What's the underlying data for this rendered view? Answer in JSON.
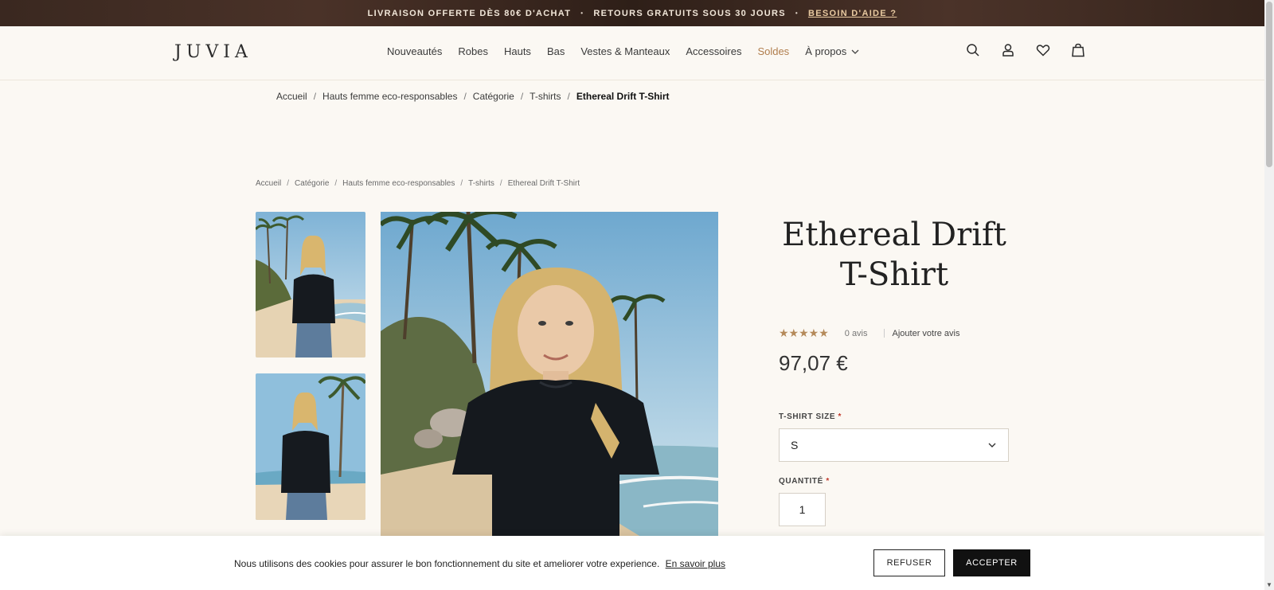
{
  "topbar": {
    "item1": "LIVRAISON OFFERTE DÈS 80€ D'ACHAT",
    "item2": "RETOURS GRATUITS SOUS 30 JOURS",
    "help": "BESOIN D'AIDE ?",
    "separator": "•"
  },
  "header": {
    "logo": "JUVIA",
    "nav": [
      "Nouveautés",
      "Robes",
      "Hauts",
      "Bas",
      "Vestes & Manteaux",
      "Accessoires",
      "Soldes",
      "À propos"
    ],
    "icons": [
      "search-icon",
      "account-icon",
      "heart-icon",
      "bag-icon"
    ]
  },
  "breadcrumb_top": [
    "Accueil",
    "Hauts femme eco-responsables",
    "Catégorie",
    "T-shirts",
    "Ethereal Drift T-Shirt"
  ],
  "breadcrumb_small": [
    "Accueil",
    "Catégorie",
    "Hauts femme eco-responsables",
    "T-shirts",
    "Ethereal Drift T-Shirt"
  ],
  "breadcrumb_separator": "/",
  "product": {
    "title": "Ethereal Drift T-Shirt",
    "rating": 5,
    "stars": "★★★★★",
    "reviews": "0 avis",
    "add_review": "Ajouter votre avis",
    "price": "97,07 €",
    "size_label": "T-SHIRT SIZE",
    "size_value": "S",
    "qty_label": "QUANTITÉ",
    "qty_value": "1",
    "required_mark": "*"
  },
  "cookie": {
    "text": "Nous utilisons des cookies pour assurer le bon fonctionnement du site et ameliorer votre experience.",
    "link": "En savoir plus",
    "refuse": "REFUSER",
    "accept": "ACCEPTER"
  },
  "colors": {
    "background": "#fbf8f3",
    "sale": "#b07d4c",
    "stars": "#b58a5a",
    "accept_button": "#111111"
  }
}
